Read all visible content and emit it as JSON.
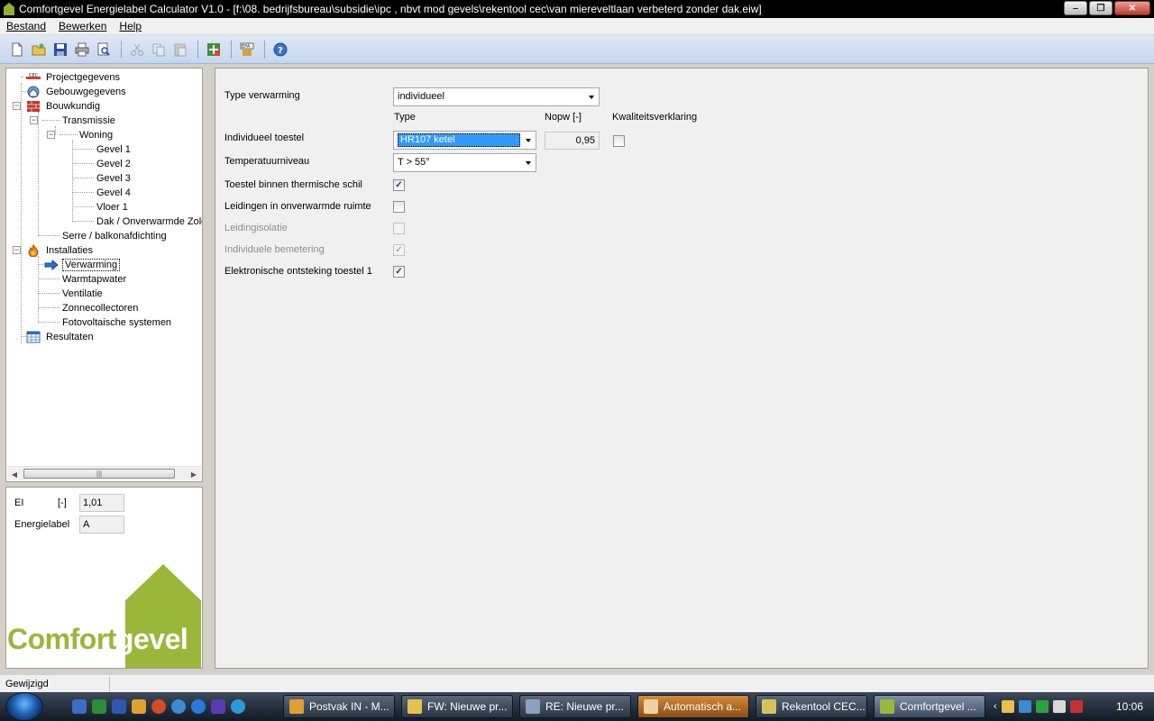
{
  "window": {
    "title": "Comfortgevel Energielabel Calculator V1.0 - [f:\\08. bedrijfsbureau\\subsidie\\ipc , nbvt mod gevels\\rekentool cec\\van miereveltlaan verbeterd zonder dak.eiw]"
  },
  "menu": {
    "bestand": "Bestand",
    "bewerken": "Bewerken",
    "help": "Help"
  },
  "tree": {
    "projectgegevens": "Projectgegevens",
    "gebouwgegevens": "Gebouwgegevens",
    "bouwkundig": "Bouwkundig",
    "transmissie": "Transmissie",
    "woning": "Woning",
    "gevel1": "Gevel 1",
    "gevel2": "Gevel 2",
    "gevel3": "Gevel 3",
    "gevel4": "Gevel 4",
    "vloer1": "Vloer 1",
    "dak": "Dak / Onverwarmde Zolder",
    "serre": "Serre / balkonafdichting",
    "installaties": "Installaties",
    "verwarming": "Verwarming",
    "warmtapwater": "Warmtapwater",
    "ventilatie": "Ventilatie",
    "zonnecollectoren": "Zonnecollectoren",
    "fotovoltaische": "Fotovoltaische systemen",
    "resultaten": "Resultaten"
  },
  "results": {
    "ei_label": "EI",
    "ei_unit": "[-]",
    "ei_value": "1,01",
    "energielabel_label": "Energielabel",
    "energielabel_value": "A"
  },
  "logo": {
    "text_a": "Comfort",
    "text_b": "gevel"
  },
  "form": {
    "type_verwarming_label": "Type verwarming",
    "type_verwarming_value": "individueel",
    "col_type": "Type",
    "col_nopw": "Nopw [-]",
    "col_kwaliteit": "Kwaliteitsverklaring",
    "individueel_toestel_label": "Individueel toestel",
    "individueel_toestel_value": "HR107 ketel",
    "nopw_value": "0,95",
    "temperatuur_label": "Temperatuurniveau",
    "temperatuur_value": "T > 55°",
    "toestel_binnen_label": "Toestel binnen thermische schil",
    "leidingen_label": "Leidingen in onverwarmde ruimte",
    "leidingisolatie_label": "Leidingisolatie",
    "bemetering_label": "Individuele bemetering",
    "ontsteking_label": "Elektronische ontsteking toestel 1",
    "check_mark": "✓"
  },
  "status": {
    "text": "Gewijzigd"
  },
  "taskbar": {
    "postvak": "Postvak IN - M...",
    "fw": "FW: Nieuwe pr...",
    "re": "RE: Nieuwe pr...",
    "automatisch": "Automatisch a...",
    "rekentool": "Rekentool CEC...",
    "comfortgevel": "Comfortgevel ...",
    "clock": "10:06"
  },
  "colors": {
    "brand_green": "#9ab73a",
    "selection_blue": "#3399ff"
  }
}
